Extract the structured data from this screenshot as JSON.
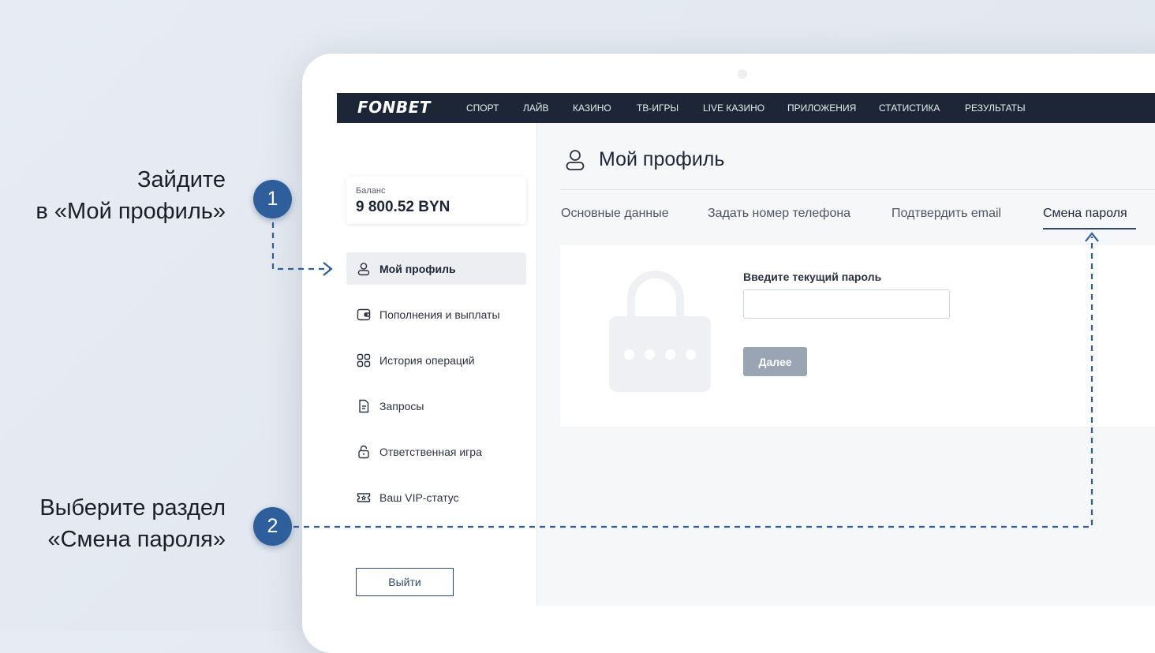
{
  "navbar": {
    "logo": "FONBET",
    "items": [
      "СПОРТ",
      "ЛАЙВ",
      "КАЗИНО",
      "ТВ-ИГРЫ",
      "LIVE КАЗИНО",
      "ПРИЛОЖЕНИЯ",
      "СТАТИСТИКА",
      "РЕЗУЛЬТАТЫ"
    ]
  },
  "sidebar": {
    "balance": {
      "label": "Баланс",
      "value": "9 800.52 BYN"
    },
    "items": [
      {
        "label": "Мой профиль",
        "icon": "user-icon",
        "active": true
      },
      {
        "label": "Пополнения и выплаты",
        "icon": "wallet-icon",
        "active": false
      },
      {
        "label": "История операций",
        "icon": "grid-icon",
        "active": false
      },
      {
        "label": "Запросы",
        "icon": "document-icon",
        "active": false
      },
      {
        "label": "Ответственная игра",
        "icon": "lock-icon",
        "active": false
      },
      {
        "label": "Ваш VIP-статус",
        "icon": "ticket-star-icon",
        "active": false
      }
    ],
    "logout_label": "Выйти"
  },
  "main": {
    "title": "Мой профиль",
    "tabs": [
      {
        "label": "Основные данные",
        "active": false
      },
      {
        "label": "Задать номер телефона",
        "active": false
      },
      {
        "label": "Подтвердить email",
        "active": false
      },
      {
        "label": "Смена пароля",
        "active": true
      }
    ],
    "form": {
      "current_password_label": "Введите текущий пароль",
      "current_password_value": "",
      "next_label": "Далее"
    }
  },
  "annotations": [
    {
      "number": "1",
      "line1": "Зайдите",
      "line2": "в «Мой профиль»"
    },
    {
      "number": "2",
      "line1": "Выберите раздел",
      "line2": "«Смена пароля»"
    }
  ],
  "colors": {
    "navbar": "#1d2637",
    "accent": "#2e4a66",
    "badge": "#2e5e9c",
    "disabled_button": "#9aa5b4"
  }
}
